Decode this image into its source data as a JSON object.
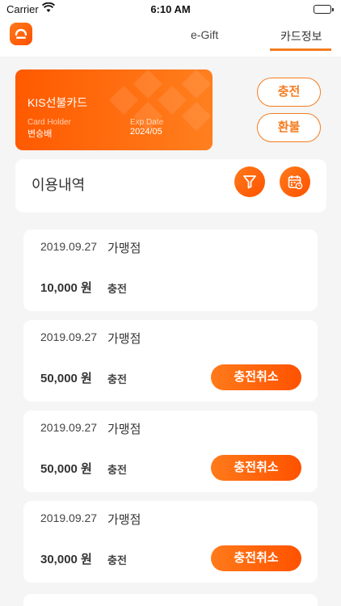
{
  "status_bar": {
    "carrier": "Carrier",
    "time": "6:10 AM"
  },
  "nav": {
    "tabs": [
      {
        "label": "e-Gift"
      },
      {
        "label": "카드정보",
        "active": true
      }
    ]
  },
  "card": {
    "name": "KIS선불카드",
    "holder_label": "Card Holder",
    "holder_value": "변승배",
    "exp_label": "Exp Date",
    "exp_value": "2024/05"
  },
  "actions": {
    "charge_label": "충전",
    "refund_label": "환불"
  },
  "usage": {
    "title": "이용내역"
  },
  "transactions": [
    {
      "date": "2019.09.27",
      "merchant": "가맹점",
      "amount": "10,000 원",
      "kind": "충전",
      "cancel_label": ""
    },
    {
      "date": "2019.09.27",
      "merchant": "가맹점",
      "amount": "50,000 원",
      "kind": "충전",
      "cancel_label": "충전취소"
    },
    {
      "date": "2019.09.27",
      "merchant": "가맹점",
      "amount": "50,000 원",
      "kind": "충전",
      "cancel_label": "충전취소"
    },
    {
      "date": "2019.09.27",
      "merchant": "가맹점",
      "amount": "30,000 원",
      "kind": "충전",
      "cancel_label": "충전취소"
    }
  ],
  "colors": {
    "accent": "#f47c20",
    "accent_dark": "#ff5200",
    "background": "#f5f5f5"
  },
  "icons": [
    "wifi-icon",
    "battery-icon",
    "home-icon",
    "filter-icon",
    "calendar-icon"
  ]
}
